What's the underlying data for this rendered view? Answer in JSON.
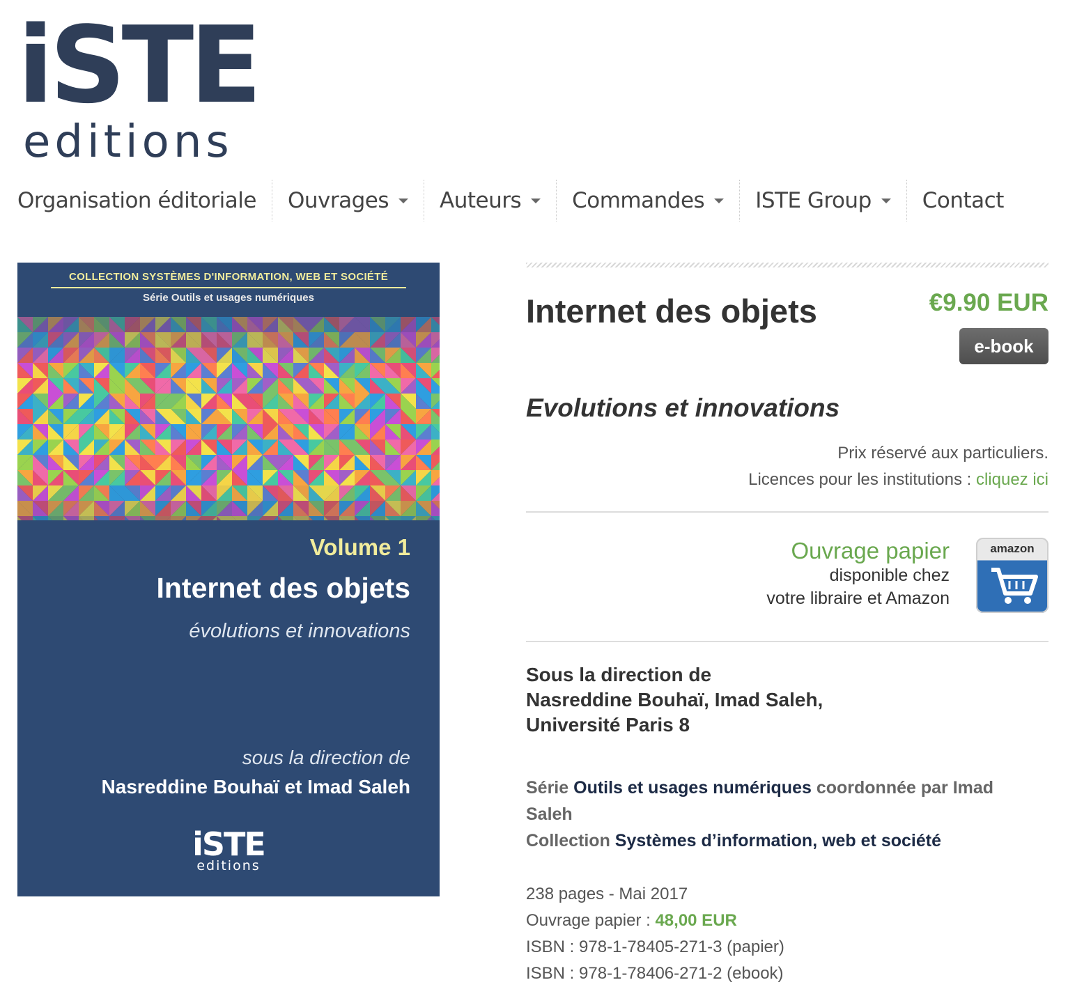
{
  "logo": {
    "wordmark": "iSTE",
    "sub": "editions"
  },
  "nav": {
    "items": [
      {
        "label": "Organisation éditoriale",
        "dropdown": false
      },
      {
        "label": "Ouvrages",
        "dropdown": true
      },
      {
        "label": "Auteurs",
        "dropdown": true
      },
      {
        "label": "Commandes",
        "dropdown": true
      },
      {
        "label": "ISTE Group",
        "dropdown": true
      },
      {
        "label": "Contact",
        "dropdown": false
      }
    ]
  },
  "cover": {
    "collection": "COLLECTION SYSTÈMES D'INFORMATION, WEB ET SOCIÉTÉ",
    "serie": "Série Outils et usages numériques",
    "volume": "Volume 1",
    "title": "Internet des objets",
    "subtitle": "évolutions et innovations",
    "direction": "sous la direction de",
    "authors": "Nasreddine Bouhaï et Imad Saleh",
    "logo": "iSTE",
    "logo_sub": "editions",
    "background_color": "#2e4a73"
  },
  "product": {
    "title": "Internet des objets",
    "price": "€9.90 EUR",
    "ebook_button": "e-book",
    "subtitle": "Evolutions et innovations",
    "prix_note": "Prix réservé aux particuliers.",
    "licences_text": "Licences pour les institutions :",
    "licences_link": "cliquez ici",
    "paper_title": "Ouvrage papier",
    "paper_line1": "disponible chez",
    "paper_line2": "votre libraire et Amazon",
    "amazon_label": "amazon",
    "direction_label": "Sous la direction de",
    "direction_authors": "Nasreddine Bouhaï, Imad Saleh,",
    "direction_affiliation": "Université Paris 8",
    "serie_label": "Série",
    "serie_link": "Outils et usages numériques",
    "serie_coord": "coordonnée par Imad Saleh",
    "collection_label": "Collection",
    "collection_link": "Systèmes d’information, web et société",
    "pages_date": "238 pages - Mai 2017",
    "paper_price_label": "Ouvrage papier :",
    "paper_price": "48,00 EUR",
    "isbn_paper": "ISBN : 978-1-78405-271-3 (papier)",
    "isbn_ebook": "ISBN : 978-1-78406-271-2 (ebook)"
  },
  "colors": {
    "accent_green": "#6aa84f",
    "brand_navy": "#2f3e58"
  }
}
